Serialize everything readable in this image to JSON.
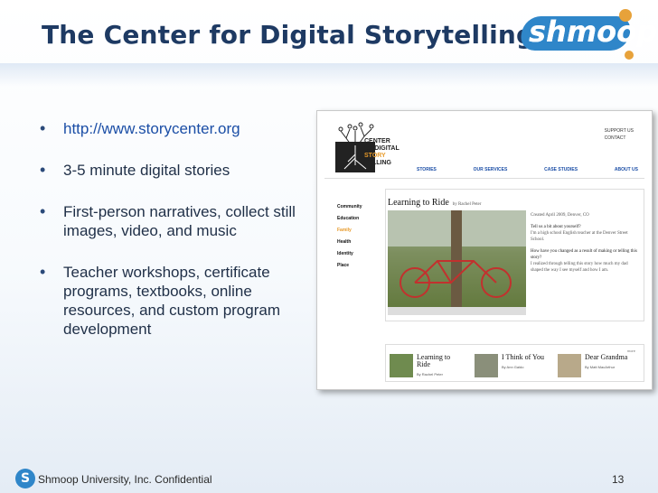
{
  "title": "The Center for Digital Storytelling",
  "logo": "shmoop",
  "bullets": [
    "http://www.storycenter.org",
    "3-5 minute digital stories",
    "First-person narratives, collect still images, video, and music",
    "Teacher workshops, certificate programs, textbooks, online resources, and custom program development"
  ],
  "screenshot": {
    "site_name_line1": "CENTER",
    "site_name_line2": "for DIGITAL",
    "site_name_line3": "STORY",
    "site_name_line4": "TELLING",
    "top_links": [
      "SUPPORT US",
      "CONTACT"
    ],
    "nav": [
      "STORIES",
      "OUR SERVICES",
      "CASE STUDIES",
      "ABOUT US"
    ],
    "side_menu": [
      "Community",
      "Education",
      "Family",
      "Health",
      "Identity",
      "Place"
    ],
    "side_menu_active": "Family",
    "main_title": "Learning to Ride",
    "main_byline": "by Rachel Peter",
    "story_meta": "Created April 2009, Denver, CO",
    "q1": "Tell us a bit about yourself?",
    "a1": "I'm a high school English teacher at the Denver Street School.",
    "q2": "How have you changed as a result of making or telling this story?",
    "a2": "I realized through telling this story how much my dad shaped the way I see myself and how I am.",
    "more_label": "more",
    "thumbs": [
      {
        "title": "Learning to Ride",
        "by": "By Rachel Peter"
      },
      {
        "title": "I Think of You",
        "by": "By Ann Galdo"
      },
      {
        "title": "Dear Grandma",
        "by": "By Matt MacArthur"
      }
    ]
  },
  "footer": {
    "logo_letter": "S",
    "text": "Shmoop University, Inc. Confidential",
    "page": "13"
  },
  "colors": {
    "title": "#1e3a63",
    "accent": "#2f86c9",
    "story_orange": "#e79a2a"
  }
}
